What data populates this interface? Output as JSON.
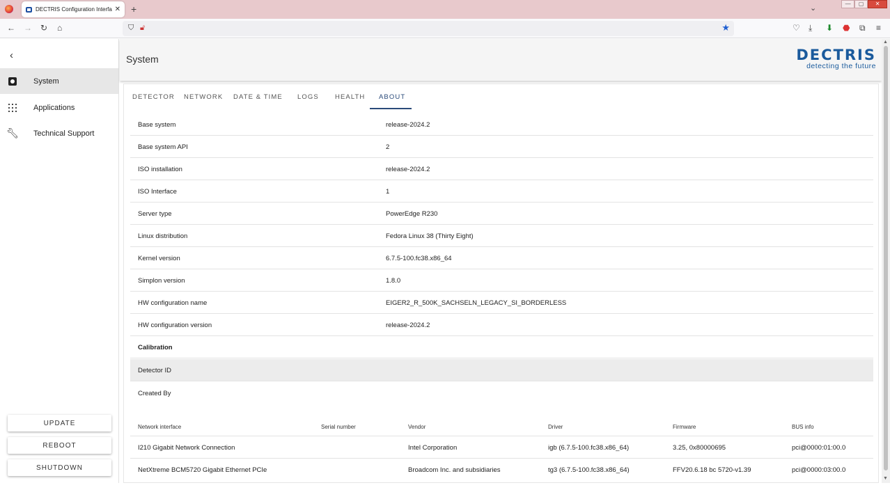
{
  "browser": {
    "tab_title": "DECTRIS Configuration Interface",
    "tab_close": "✕",
    "new_tab": "+",
    "tab_list": "⌄",
    "window_controls": [
      "—",
      "▢",
      "✕"
    ]
  },
  "sidebar": {
    "collapse_icon": "chevron-left-icon",
    "items": [
      {
        "label": "System",
        "icon": "system-icon",
        "active": true
      },
      {
        "label": "Applications",
        "icon": "apps-grid-icon",
        "active": false
      },
      {
        "label": "Technical Support",
        "icon": "wrench-icon",
        "active": false
      }
    ],
    "buttons": {
      "update": "UPDATE",
      "reboot": "REBOOT",
      "shutdown": "SHUTDOWN"
    }
  },
  "header": {
    "title": "System",
    "logo_word": "DECTRIS",
    "logo_tagline": "detecting the future"
  },
  "tabs": [
    {
      "label": "DETECTOR"
    },
    {
      "label": "NETWORK"
    },
    {
      "label": "DATE & TIME"
    },
    {
      "label": "LOGS"
    },
    {
      "label": "HEALTH"
    },
    {
      "label": "ABOUT",
      "active": true
    }
  ],
  "about": {
    "rows": [
      {
        "key": "Base system",
        "value": "release-2024.2"
      },
      {
        "key": "Base system API",
        "value": "2"
      },
      {
        "key": "ISO installation",
        "value": "release-2024.2"
      },
      {
        "key": "ISO Interface",
        "value": "1"
      },
      {
        "key": "Server type",
        "value": "PowerEdge R230"
      },
      {
        "key": "Linux distribution",
        "value": "Fedora Linux 38 (Thirty Eight)"
      },
      {
        "key": "Kernel version",
        "value": "6.7.5-100.fc38.x86_64"
      },
      {
        "key": "Simplon version",
        "value": "1.8.0"
      },
      {
        "key": "HW configuration name",
        "value": "EIGER2_R_500K_SACHSELN_LEGACY_SI_BORDERLESS"
      },
      {
        "key": "HW configuration version",
        "value": "release-2024.2"
      }
    ],
    "calibration": {
      "title": "Calibration",
      "detector_id_label": "Detector ID",
      "created_by_label": "Created By"
    }
  },
  "network_table": {
    "headers": [
      "Network interface",
      "Serial number",
      "Vendor",
      "Driver",
      "Firmware",
      "BUS info"
    ],
    "rows": [
      [
        "I210 Gigabit Network Connection",
        "",
        "Intel Corporation",
        "igb (6.7.5-100.fc38.x86_64)",
        "3.25, 0x80000695",
        "pci@0000:01:00.0"
      ],
      [
        "NetXtreme BCM5720 Gigabit Ethernet PCIe",
        "",
        "Broadcom Inc. and subsidiaries",
        "tg3 (6.7.5-100.fc38.x86_64)",
        "FFV20.6.18 bc 5720-v1.39",
        "pci@0000:03:00.0"
      ]
    ]
  },
  "colors": {
    "brand": "#1a5a9c",
    "active_tab": "#2a4a7a",
    "tabbar_bg": "#e8c9cc",
    "bookmark_star": "#1f5fd1"
  }
}
